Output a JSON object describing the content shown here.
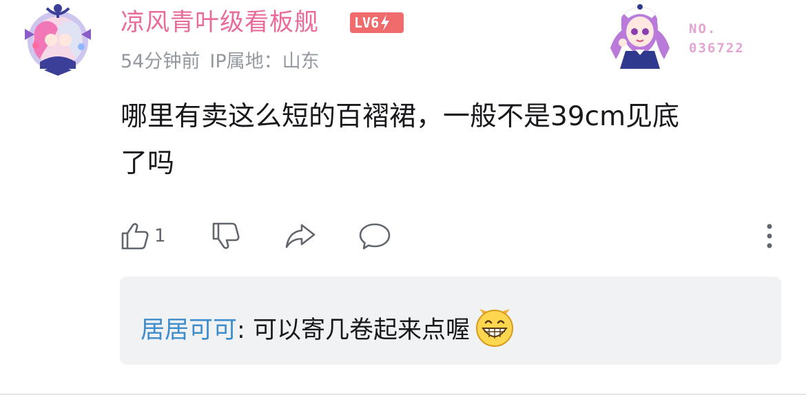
{
  "comment": {
    "username": "凉风青叶级看板舰",
    "level_badge": "LV6",
    "time": "54分钟前",
    "ip_location": "IP属地：山东",
    "fan_badge": {
      "prefix": "NO.",
      "number": "036722"
    },
    "text_lines": [
      "哪里有卖这么短的百褶裙，一般不是39cm见底",
      "了吗"
    ],
    "actions": {
      "like_count": "1"
    }
  },
  "reply": {
    "user": "居居可可",
    "separator": ": ",
    "text": "可以寄几卷起来点喔"
  },
  "colors": {
    "username": "#ea6a99",
    "level_badge": "#f06b6b",
    "meta": "#9499a0",
    "reply_user": "#3d8ccb",
    "reply_bg": "#f1f2f3",
    "fan_badge": "#e3a4d1"
  },
  "icons": {
    "avatar": "anime-avatar-with-anchor-frame",
    "level_bolt": "lightning-bolt-icon",
    "fan_avatar": "anime-maid-character",
    "like": "thumbs-up-icon",
    "dislike": "thumbs-down-icon",
    "share": "share-arrow-icon",
    "reply": "speech-bubble-icon",
    "more": "vertical-dots-icon",
    "emoji": "grinning-emoji"
  }
}
